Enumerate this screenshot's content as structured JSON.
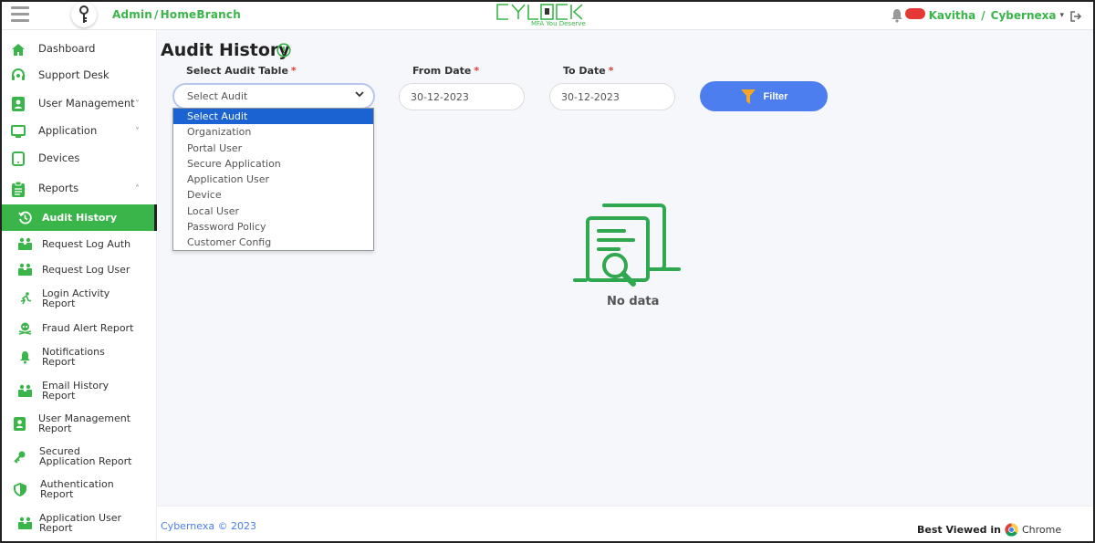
{
  "header": {
    "breadcrumb_first": "Admin",
    "breadcrumb_sep": "/",
    "breadcrumb_second": "HomeBranch",
    "logo_word": "CYLOCK",
    "logo_tagline": "MFA You Deserve",
    "notification_count": "",
    "user_name": "Kavitha",
    "user_sep": "/",
    "org_name": "Cybernexa",
    "accent_color": "#3ab54a"
  },
  "sidebar": {
    "items": [
      {
        "label": "Dashboard",
        "icon": "home-icon"
      },
      {
        "label": "Support Desk",
        "icon": "headset-icon"
      },
      {
        "label": "User Management",
        "icon": "user-card-icon",
        "chevron": "˅"
      },
      {
        "label": "Application",
        "icon": "monitor-icon",
        "chevron": "˅"
      },
      {
        "label": "Devices",
        "icon": "tablet-icon"
      },
      {
        "label": "Reports",
        "icon": "clipboard-icon",
        "chevron": "˄"
      }
    ],
    "reports": [
      {
        "label": "Audit History",
        "icon": "history-icon",
        "active": true
      },
      {
        "label": "Request Log Auth",
        "icon": "users-icon"
      },
      {
        "label": "Request Log User",
        "icon": "users-icon"
      },
      {
        "label": "Login Activity Report",
        "line1": "Login Activity",
        "line2": "Report",
        "icon": "running-person-icon"
      },
      {
        "label": "Fraud Alert Report",
        "icon": "skull-icon"
      },
      {
        "label": "Notifications Report",
        "line1": "Notifications",
        "line2": "Report",
        "icon": "bell-icon"
      },
      {
        "label": "Email History Report",
        "line1": "Email History",
        "line2": "Report",
        "icon": "users-icon"
      },
      {
        "label": "User Management Report",
        "line1": "User Management",
        "line2": "Report",
        "icon": "user-card-icon"
      },
      {
        "label": "Secured Application Report",
        "line1": "Secured",
        "line2": "Application Report",
        "icon": "key-icon"
      },
      {
        "label": "Authentication Report",
        "line1": "Authentication",
        "line2": "Report",
        "icon": "shield-icon"
      },
      {
        "label": "Application User Report",
        "line1": "Application User",
        "line2": "Report",
        "icon": "users-icon"
      }
    ]
  },
  "main": {
    "title": "Audit History",
    "select_label": "Select Audit Table",
    "from_label": "From Date",
    "to_label": "To Date",
    "required_mark": "*",
    "select_value": "Select Audit",
    "from_date": "30-12-2023",
    "to_date": "30-12-2023",
    "filter_label": "Filter",
    "dropdown_options": [
      "Select Audit",
      "Organization",
      "Portal User",
      "Secure Application",
      "Application User",
      "Device",
      "Local User",
      "Password Policy",
      "Customer Config"
    ],
    "empty_text": "No data"
  },
  "footer": {
    "copyright": "Cybernexa ©  2023",
    "best_viewed": "Best Viewed in",
    "browser": "Chrome"
  }
}
